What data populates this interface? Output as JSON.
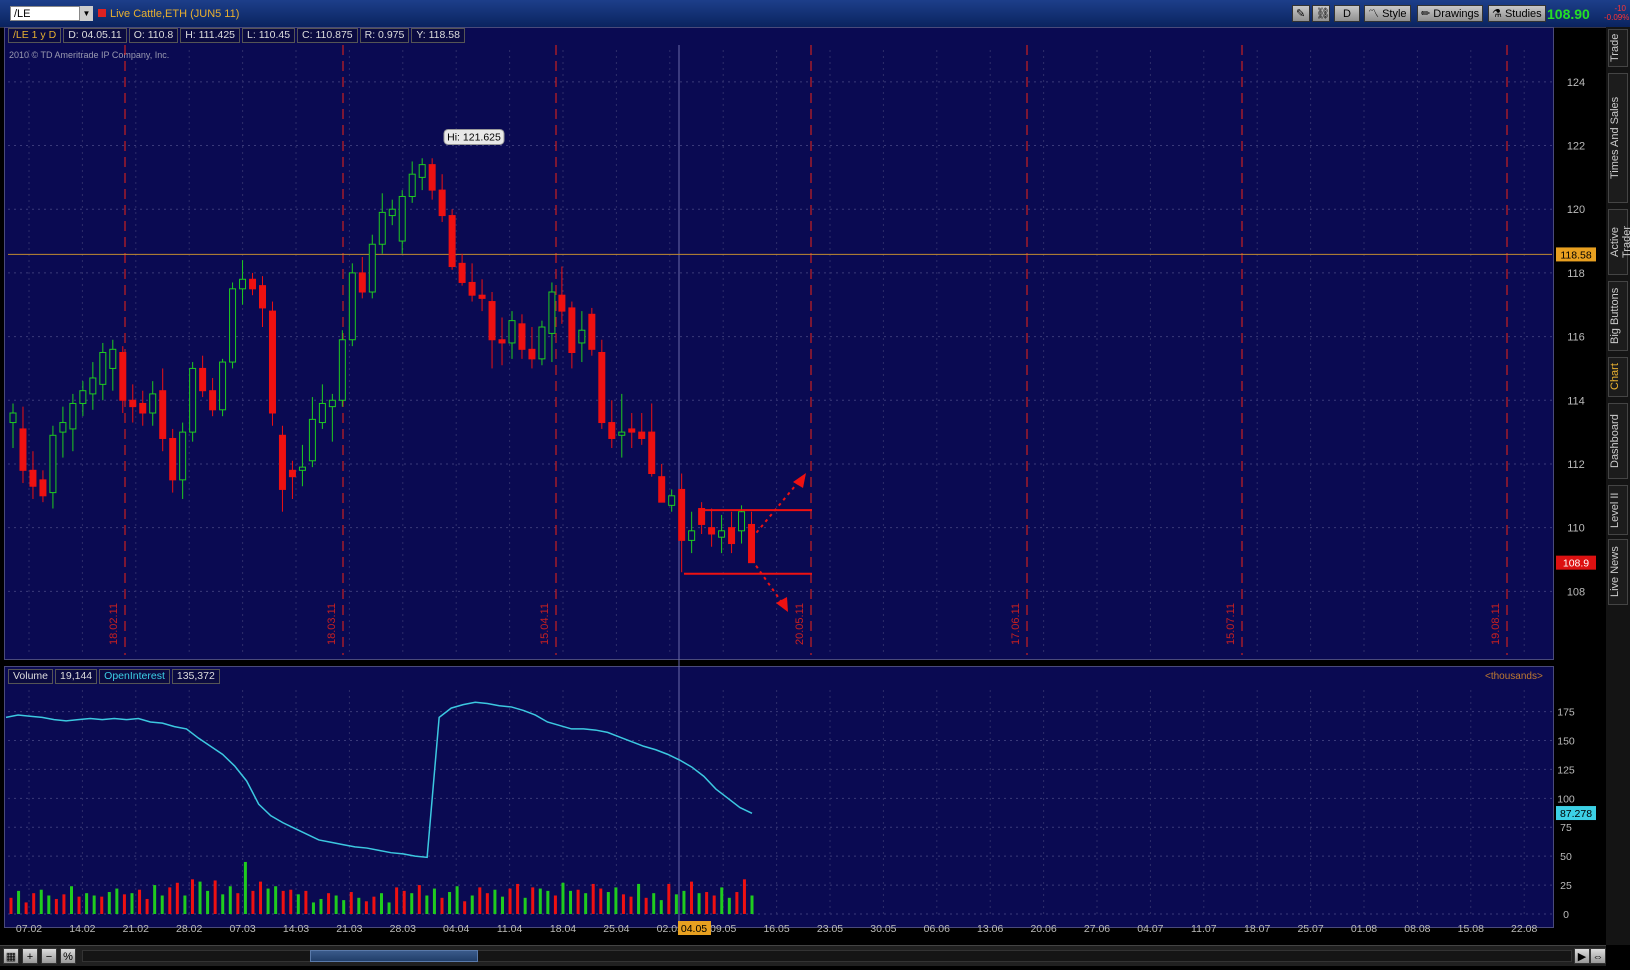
{
  "topbar": {
    "symbol": "/LE",
    "title": "Live Cattle,ETH (JUN5 11)",
    "btn_d": "D",
    "btn_style": "Style",
    "btn_drawings": "Drawings",
    "btn_studies": "Studies",
    "last_price": "108.90",
    "net_change": "-10",
    "pct_change": "-0.09%"
  },
  "info": {
    "ticker": "/LE 1 y D",
    "date": "D: 04.05.11",
    "open": "O: 110.8",
    "high": "H: 111.425",
    "low": "L: 110.45",
    "close": "C: 110.875",
    "range": "R: 0.975",
    "y": "Y: 118.58"
  },
  "copyright": "2010 © TD Ameritrade IP Company, Inc.",
  "side_tabs": [
    "Trade",
    "Times And Sales",
    "Active Trader",
    "Big Buttons",
    "Chart",
    "Dashboard",
    "Level II",
    "Live News"
  ],
  "active_tab": "Chart",
  "chart_data": [
    {
      "type": "candlestick",
      "symbol": "/LE",
      "ylim": [
        106,
        125
      ],
      "yticks": [
        108,
        110,
        112,
        114,
        116,
        118,
        120,
        122,
        124
      ],
      "crosshair_y": 118.58,
      "last_price_label": "108.9",
      "crosshair_label": "118.58",
      "hi_label": "Hi: 121.625",
      "expiry_labels": [
        "18.02.11",
        "18.03.11",
        "15.04.11",
        "20.05.11",
        "17.06.11",
        "15.07.11",
        "19.08.11"
      ],
      "candles": [
        {
          "o": 113.3,
          "h": 113.9,
          "l": 112.5,
          "c": 113.6
        },
        {
          "o": 113.1,
          "h": 113.8,
          "l": 111.4,
          "c": 111.8
        },
        {
          "o": 111.8,
          "h": 112.4,
          "l": 110.9,
          "c": 111.3
        },
        {
          "o": 111.5,
          "h": 111.8,
          "l": 110.8,
          "c": 111.0
        },
        {
          "o": 111.1,
          "h": 113.2,
          "l": 110.6,
          "c": 112.9
        },
        {
          "o": 113.0,
          "h": 113.8,
          "l": 112.2,
          "c": 113.3
        },
        {
          "o": 113.1,
          "h": 114.2,
          "l": 112.4,
          "c": 113.9
        },
        {
          "o": 113.9,
          "h": 114.6,
          "l": 113.5,
          "c": 114.3
        },
        {
          "o": 114.2,
          "h": 115.2,
          "l": 113.7,
          "c": 114.7
        },
        {
          "o": 114.5,
          "h": 115.8,
          "l": 114.0,
          "c": 115.5
        },
        {
          "o": 115.0,
          "h": 115.9,
          "l": 114.3,
          "c": 115.6
        },
        {
          "o": 115.5,
          "h": 115.7,
          "l": 113.6,
          "c": 114.0
        },
        {
          "o": 114.0,
          "h": 114.5,
          "l": 113.3,
          "c": 113.8
        },
        {
          "o": 113.9,
          "h": 114.3,
          "l": 113.2,
          "c": 113.6
        },
        {
          "o": 113.6,
          "h": 114.6,
          "l": 113.2,
          "c": 114.2
        },
        {
          "o": 114.3,
          "h": 115.0,
          "l": 112.4,
          "c": 112.8
        },
        {
          "o": 112.8,
          "h": 113.1,
          "l": 111.1,
          "c": 111.5
        },
        {
          "o": 111.5,
          "h": 113.3,
          "l": 110.9,
          "c": 113.0
        },
        {
          "o": 113.0,
          "h": 115.2,
          "l": 112.7,
          "c": 115.0
        },
        {
          "o": 115.0,
          "h": 115.4,
          "l": 114.1,
          "c": 114.3
        },
        {
          "o": 114.3,
          "h": 114.7,
          "l": 113.5,
          "c": 113.7
        },
        {
          "o": 113.7,
          "h": 115.3,
          "l": 113.5,
          "c": 115.2
        },
        {
          "o": 115.2,
          "h": 117.7,
          "l": 115.0,
          "c": 117.5
        },
        {
          "o": 117.5,
          "h": 118.4,
          "l": 117.0,
          "c": 117.8
        },
        {
          "o": 117.8,
          "h": 118.0,
          "l": 117.3,
          "c": 117.5
        },
        {
          "o": 117.6,
          "h": 117.9,
          "l": 116.3,
          "c": 116.9
        },
        {
          "o": 116.8,
          "h": 117.1,
          "l": 113.2,
          "c": 113.6
        },
        {
          "o": 112.9,
          "h": 113.2,
          "l": 110.5,
          "c": 111.2
        },
        {
          "o": 111.8,
          "h": 112.1,
          "l": 110.9,
          "c": 111.6
        },
        {
          "o": 111.8,
          "h": 112.6,
          "l": 111.3,
          "c": 111.9
        },
        {
          "o": 112.1,
          "h": 114.1,
          "l": 111.9,
          "c": 113.4
        },
        {
          "o": 113.3,
          "h": 114.5,
          "l": 113.1,
          "c": 113.9
        },
        {
          "o": 113.8,
          "h": 114.2,
          "l": 112.7,
          "c": 114.0
        },
        {
          "o": 114.0,
          "h": 116.2,
          "l": 113.8,
          "c": 115.9
        },
        {
          "o": 115.9,
          "h": 118.3,
          "l": 115.7,
          "c": 118.0
        },
        {
          "o": 118.0,
          "h": 118.5,
          "l": 117.2,
          "c": 117.4
        },
        {
          "o": 117.4,
          "h": 119.2,
          "l": 117.2,
          "c": 118.9
        },
        {
          "o": 118.9,
          "h": 120.5,
          "l": 118.6,
          "c": 119.9
        },
        {
          "o": 119.8,
          "h": 120.3,
          "l": 119.5,
          "c": 120.0
        },
        {
          "o": 119.0,
          "h": 120.6,
          "l": 118.6,
          "c": 120.4
        },
        {
          "o": 120.4,
          "h": 121.5,
          "l": 120.2,
          "c": 121.1
        },
        {
          "o": 121.0,
          "h": 121.6,
          "l": 120.6,
          "c": 121.4
        },
        {
          "o": 121.4,
          "h": 121.6,
          "l": 120.3,
          "c": 120.6
        },
        {
          "o": 120.6,
          "h": 121.1,
          "l": 119.6,
          "c": 119.8
        },
        {
          "o": 119.8,
          "h": 120.0,
          "l": 118.1,
          "c": 118.2
        },
        {
          "o": 118.3,
          "h": 118.6,
          "l": 117.6,
          "c": 117.7
        },
        {
          "o": 117.7,
          "h": 118.3,
          "l": 117.1,
          "c": 117.3
        },
        {
          "o": 117.3,
          "h": 117.8,
          "l": 116.8,
          "c": 117.2
        },
        {
          "o": 117.1,
          "h": 117.4,
          "l": 115.0,
          "c": 115.9
        },
        {
          "o": 115.9,
          "h": 116.6,
          "l": 115.1,
          "c": 115.8
        },
        {
          "o": 115.8,
          "h": 116.8,
          "l": 115.3,
          "c": 116.5
        },
        {
          "o": 116.4,
          "h": 116.7,
          "l": 115.3,
          "c": 115.6
        },
        {
          "o": 115.6,
          "h": 116.3,
          "l": 115.0,
          "c": 115.3
        },
        {
          "o": 115.3,
          "h": 116.5,
          "l": 115.1,
          "c": 116.3
        },
        {
          "o": 116.1,
          "h": 117.7,
          "l": 115.2,
          "c": 117.4
        },
        {
          "o": 117.3,
          "h": 118.2,
          "l": 116.4,
          "c": 116.8
        },
        {
          "o": 116.9,
          "h": 117.1,
          "l": 115.0,
          "c": 115.5
        },
        {
          "o": 115.8,
          "h": 116.8,
          "l": 115.2,
          "c": 116.2
        },
        {
          "o": 116.7,
          "h": 116.9,
          "l": 115.4,
          "c": 115.6
        },
        {
          "o": 115.5,
          "h": 115.9,
          "l": 113.1,
          "c": 113.3
        },
        {
          "o": 113.3,
          "h": 114.0,
          "l": 112.5,
          "c": 112.8
        },
        {
          "o": 112.9,
          "h": 114.2,
          "l": 112.2,
          "c": 113.0
        },
        {
          "o": 113.1,
          "h": 113.6,
          "l": 112.5,
          "c": 113.0
        },
        {
          "o": 113.0,
          "h": 113.6,
          "l": 112.6,
          "c": 112.8
        },
        {
          "o": 113.0,
          "h": 113.9,
          "l": 111.6,
          "c": 111.7
        },
        {
          "o": 111.6,
          "h": 112.0,
          "l": 110.9,
          "c": 110.8
        },
        {
          "o": 110.7,
          "h": 111.2,
          "l": 110.5,
          "c": 111.0
        },
        {
          "o": 111.2,
          "h": 111.7,
          "l": 108.6,
          "c": 109.6
        },
        {
          "o": 109.6,
          "h": 110.5,
          "l": 109.2,
          "c": 109.9
        },
        {
          "o": 110.6,
          "h": 110.8,
          "l": 109.8,
          "c": 110.1
        },
        {
          "o": 110.0,
          "h": 110.6,
          "l": 109.4,
          "c": 109.8
        },
        {
          "o": 109.7,
          "h": 110.4,
          "l": 109.2,
          "c": 109.9
        },
        {
          "o": 110.0,
          "h": 110.5,
          "l": 109.2,
          "c": 109.5
        },
        {
          "o": 109.9,
          "h": 110.7,
          "l": 109.5,
          "c": 110.5
        },
        {
          "o": 110.1,
          "h": 110.5,
          "l": 109.2,
          "c": 108.9
        }
      ],
      "annotation_box": {
        "top": 110.55,
        "bottom": 108.55
      }
    },
    {
      "type": "bar+line",
      "title_volume": "Volume",
      "volume_value": "19,144",
      "title_oi": "OpenInterest",
      "oi_value": "135,372",
      "unit_label": "<thousands>",
      "ylim": [
        0,
        185
      ],
      "yticks": [
        0,
        25,
        50,
        75,
        100,
        125,
        150,
        175
      ],
      "oi_last_label": "87.278",
      "x_labels": [
        "07.02",
        "14.02",
        "21.02",
        "28.02",
        "07.03",
        "14.03",
        "21.03",
        "28.03",
        "04.04",
        "11.04",
        "18.04",
        "25.04",
        "02.05",
        "09.05",
        "16.05",
        "23.05",
        "30.05",
        "06.06",
        "13.06",
        "20.06",
        "27.06",
        "04.07",
        "11.07",
        "18.07",
        "25.07",
        "01.08",
        "08.08",
        "15.08",
        "22.08"
      ],
      "cursor_date": "04.05",
      "volume": [
        14,
        20,
        10,
        18,
        21,
        16,
        13,
        17,
        24,
        15,
        18,
        16,
        15,
        19,
        22,
        17,
        18,
        21,
        13,
        25,
        16,
        23,
        27,
        16,
        30,
        28,
        20,
        29,
        17,
        24,
        18,
        45,
        20,
        28,
        22,
        24,
        20,
        21,
        17,
        20,
        10,
        13,
        18,
        16,
        12,
        19,
        14,
        11,
        15,
        18,
        10,
        23,
        20,
        18,
        25,
        16,
        22,
        14,
        19,
        24,
        11,
        16,
        23,
        18,
        21,
        15,
        22,
        26,
        14,
        23,
        22,
        20,
        16,
        27,
        20,
        21,
        18,
        26,
        22,
        19,
        23,
        17,
        15,
        26,
        14,
        18,
        12,
        26,
        17,
        20,
        28,
        18,
        19,
        16,
        23,
        14,
        19,
        30,
        16
      ],
      "open_interest": [
        170,
        172,
        171,
        170,
        168,
        167,
        168,
        169,
        168,
        169,
        168,
        169,
        166,
        165,
        162,
        160,
        152,
        145,
        138,
        128,
        115,
        95,
        85,
        79,
        74,
        69,
        64,
        62,
        60,
        58,
        57,
        55,
        53,
        52,
        50,
        49,
        170,
        178,
        181,
        183,
        182,
        180,
        179,
        176,
        172,
        166,
        163,
        160,
        160,
        159,
        157,
        153,
        149,
        145,
        142,
        138,
        133,
        127,
        119,
        108,
        100,
        92,
        87
      ]
    }
  ]
}
